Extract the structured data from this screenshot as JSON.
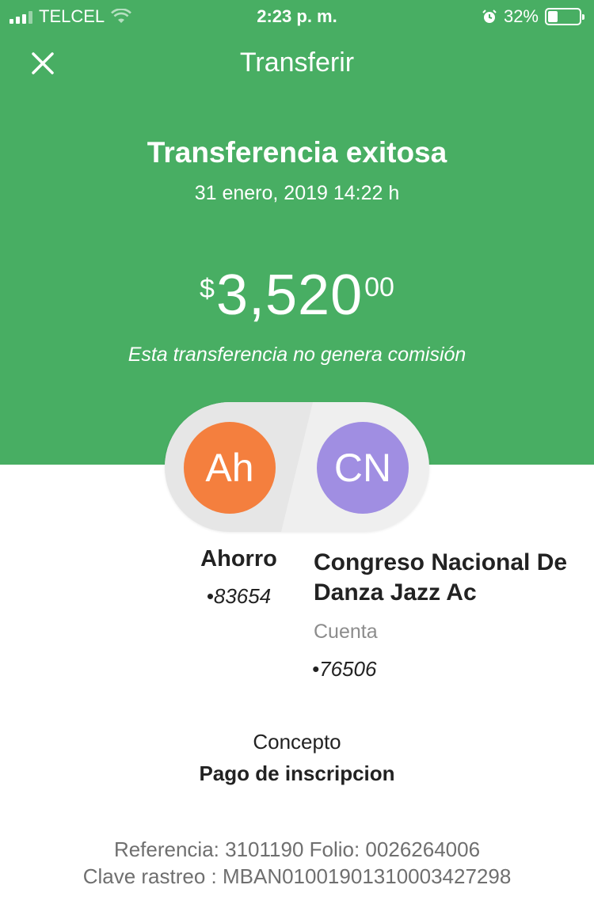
{
  "status_bar": {
    "carrier": "TELCEL",
    "time": "2:23 p. m.",
    "battery_percent": "32%",
    "battery_level": 0.32,
    "icons": [
      "signal-icon",
      "wifi-icon",
      "alarm-icon",
      "battery-icon"
    ]
  },
  "nav": {
    "title": "Transferir",
    "close_icon": "close-icon"
  },
  "receipt": {
    "title": "Transferencia exitosa",
    "datetime": "31 enero, 2019 14:22 h",
    "amount": {
      "currency": "$",
      "integer": "3,520",
      "decimals": "00"
    },
    "commission_note": "Esta transferencia no genera comisión"
  },
  "from_account": {
    "initials": "Ah",
    "name": "Ahorro",
    "number": "83654",
    "avatar_color": "#f47f3e"
  },
  "to_account": {
    "initials": "CN",
    "name": "Congreso Nacional De Danza Jazz Ac",
    "type": "Cuenta",
    "number": "76506",
    "avatar_color": "#a08ee2"
  },
  "concept": {
    "label": "Concepto",
    "value": "Pago de inscripcion"
  },
  "details": {
    "reference_line": "Referencia: 3101190 Folio: 0026264006",
    "trace_line": "Clave rastreo : MBAN01001901310003427298"
  },
  "colors": {
    "brand_green": "#48ae63"
  }
}
